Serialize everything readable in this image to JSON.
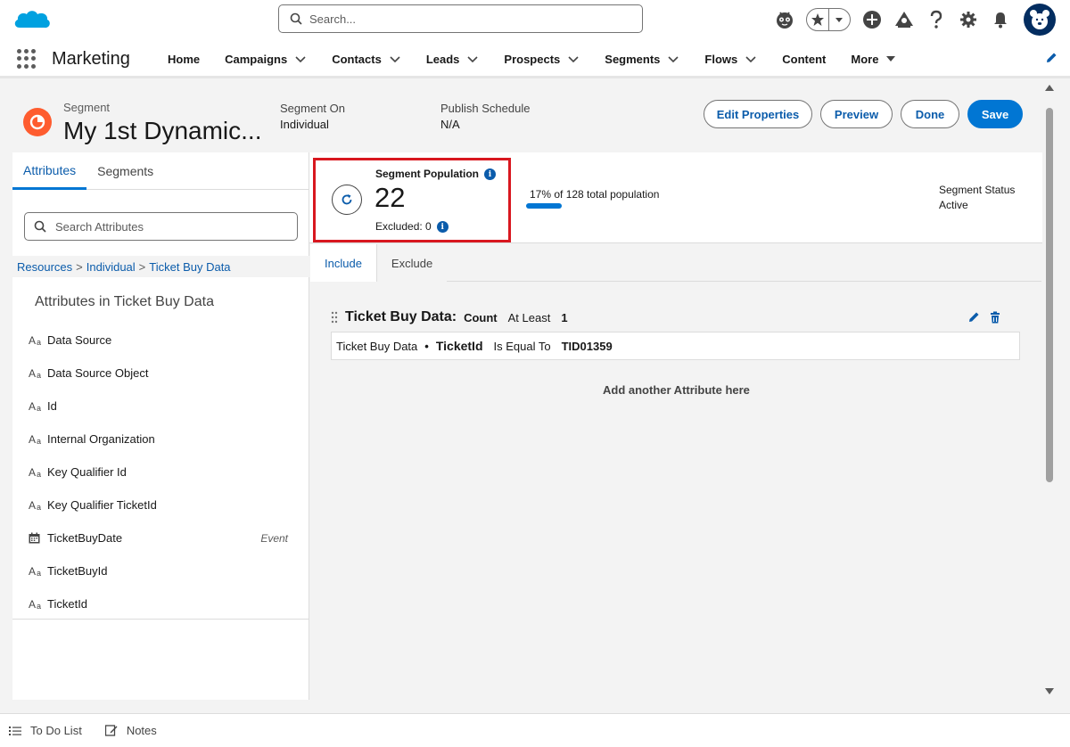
{
  "header": {
    "search_placeholder": "Search...",
    "icons": [
      "salesforce-logo",
      "einstein-icon",
      "favorites-star-icon",
      "favorites-dropdown-icon",
      "global-add-icon",
      "trailhead-icon",
      "help-icon",
      "setup-gear-icon",
      "notifications-bell-icon",
      "user-avatar"
    ]
  },
  "nav": {
    "app_name": "Marketing",
    "items": [
      {
        "label": "Home",
        "dropdown": false
      },
      {
        "label": "Campaigns",
        "dropdown": true
      },
      {
        "label": "Contacts",
        "dropdown": true
      },
      {
        "label": "Leads",
        "dropdown": true
      },
      {
        "label": "Prospects",
        "dropdown": true
      },
      {
        "label": "Segments",
        "dropdown": true
      },
      {
        "label": "Flows",
        "dropdown": true
      },
      {
        "label": "Content",
        "dropdown": false
      },
      {
        "label": "More",
        "dropdown": true
      }
    ]
  },
  "segment": {
    "kind": "Segment",
    "title": "My 1st Dynamic...",
    "segment_on_label": "Segment On",
    "segment_on_value": "Individual",
    "publish_schedule_label": "Publish Schedule",
    "publish_schedule_value": "N/A",
    "buttons": {
      "edit_properties": "Edit Properties",
      "preview": "Preview",
      "done": "Done",
      "save": "Save"
    }
  },
  "left_panel": {
    "tabs": [
      "Attributes",
      "Segments"
    ],
    "active_tab": "Attributes",
    "search_placeholder": "Search Attributes",
    "breadcrumb": [
      "Resources",
      "Individual",
      "Ticket Buy Data"
    ],
    "heading": "Attributes in Ticket Buy Data",
    "attributes": [
      {
        "name": "Data Source",
        "type": "text",
        "tag": ""
      },
      {
        "name": "Data Source Object",
        "type": "text",
        "tag": ""
      },
      {
        "name": "Id",
        "type": "text",
        "tag": ""
      },
      {
        "name": "Internal Organization",
        "type": "text",
        "tag": ""
      },
      {
        "name": "Key Qualifier Id",
        "type": "text",
        "tag": ""
      },
      {
        "name": "Key Qualifier TicketId",
        "type": "text",
        "tag": ""
      },
      {
        "name": "TicketBuyDate",
        "type": "date",
        "tag": "Event"
      },
      {
        "name": "TicketBuyId",
        "type": "text",
        "tag": ""
      },
      {
        "name": "TicketId",
        "type": "text",
        "tag": ""
      }
    ]
  },
  "population": {
    "label": "Segment Population",
    "count": "22",
    "excluded": "Excluded: 0",
    "summary": "17% of 128 total population",
    "percent": 17,
    "status_label": "Segment Status",
    "status_value": "Active",
    "highlight_color": "#d8171f"
  },
  "rules": {
    "tabs": [
      "Include",
      "Exclude"
    ],
    "active_tab": "Include",
    "group": {
      "title": "Ticket Buy Data:",
      "aggregate": "Count",
      "operator": "At Least",
      "value": "1"
    },
    "condition": {
      "object": "Ticket Buy Data",
      "separator": "•",
      "field": "TicketId",
      "operator": "Is Equal To",
      "value": "TID01359"
    },
    "add_prompt": "Add another Attribute here"
  },
  "utility_bar": {
    "items": [
      "To Do List",
      "Notes"
    ]
  },
  "colors": {
    "brand": "#0176d3",
    "link": "#0b5cab",
    "segment_icon": "#fe5c2f",
    "salesforce_cloud": "#00a1e0"
  }
}
